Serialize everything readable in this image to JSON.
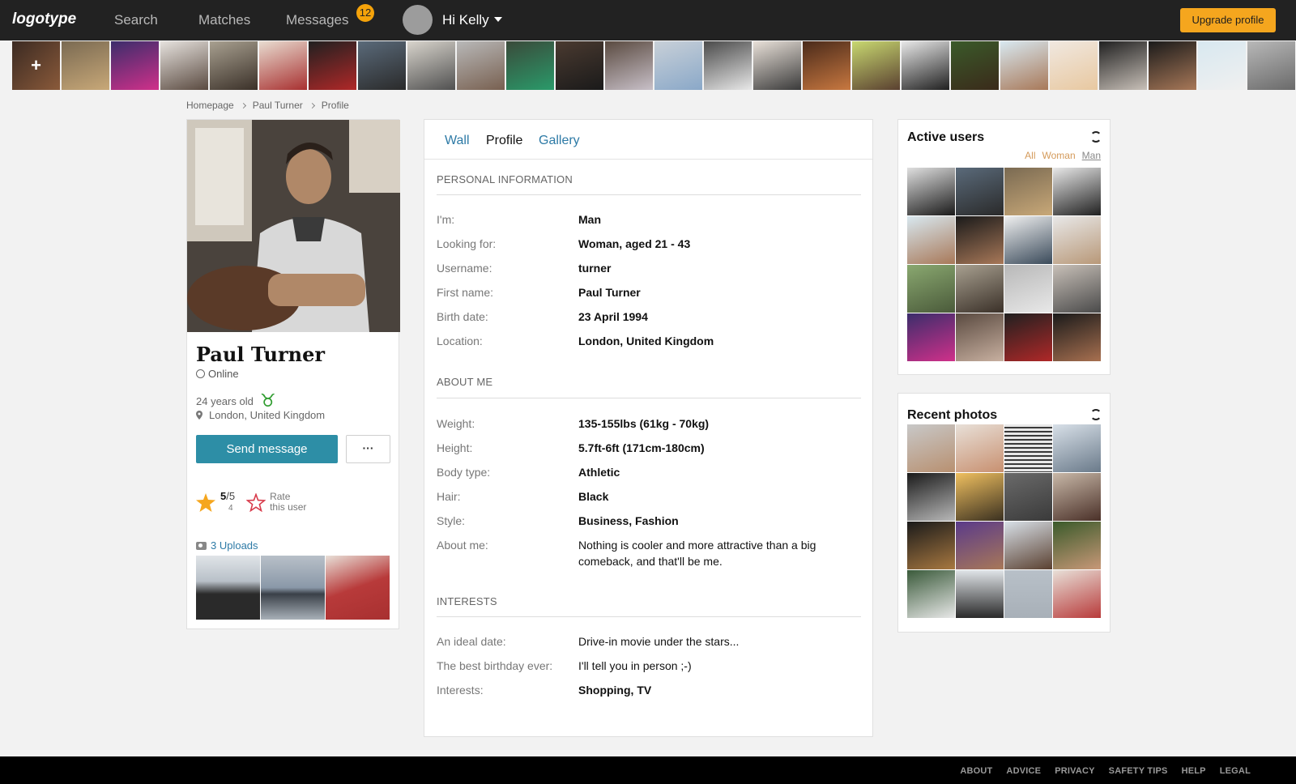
{
  "nav": {
    "logo": "logotype",
    "links": [
      "Search",
      "Matches",
      "Messages"
    ],
    "messages_badge": "12",
    "greeting": "Hi Kelly",
    "upgrade_label": "Upgrade profile"
  },
  "breadcrumb": [
    "Homepage",
    "Paul Turner",
    "Profile"
  ],
  "profile": {
    "name": "Paul Turner",
    "status": "Online",
    "age": "24 years old",
    "zodiac": "♉",
    "location": "London, United Kingdom",
    "send_message_label": "Send message",
    "more_label": "···",
    "rating_value": "5",
    "rating_max": "/5",
    "rating_count": "4",
    "rate_label_1": "Rate",
    "rate_label_2": "this user",
    "uploads_label": "3 Uploads"
  },
  "tabs": [
    "Wall",
    "Profile",
    "Gallery"
  ],
  "sections": {
    "personal": {
      "title": "PERSONAL INFORMATION",
      "rows": [
        {
          "label": "I'm:",
          "value": "Man"
        },
        {
          "label": "Looking for:",
          "value": "Woman, aged 21 - 43"
        },
        {
          "label": "Username:",
          "value": "turner"
        },
        {
          "label": "First name:",
          "value": "Paul Turner"
        },
        {
          "label": "Birth date:",
          "value": "23 April 1994"
        },
        {
          "label": "Location:",
          "value": "London, United Kingdom"
        }
      ]
    },
    "about": {
      "title": "ABOUT ME",
      "rows": [
        {
          "label": "Weight:",
          "value": "135-155lbs (61kg - 70kg)"
        },
        {
          "label": "Height:",
          "value": "5.7ft-6ft (171cm-180cm)"
        },
        {
          "label": "Body type:",
          "value": "Athletic"
        },
        {
          "label": "Hair:",
          "value": "Black"
        },
        {
          "label": "Style:",
          "value": "Business, Fashion"
        },
        {
          "label": "About me:",
          "value": "Nothing is cooler and more attractive than a big comeback, and that'll be me."
        }
      ]
    },
    "interests": {
      "title": "INTERESTS",
      "rows": [
        {
          "label": "An ideal date:",
          "value": "Drive-in movie under the stars..."
        },
        {
          "label": "The best birthday ever:",
          "value": "I'll tell you in person ;-)"
        },
        {
          "label": "Interests:",
          "value": "Shopping, TV"
        }
      ]
    }
  },
  "active_users": {
    "title": "Active users",
    "filters": [
      "All",
      "Woman",
      "Man"
    ]
  },
  "recent_photos": {
    "title": "Recent photos"
  },
  "footer": [
    "ABOUT",
    "ADVICE",
    "PRIVACY",
    "SAFETY TIPS",
    "HELP",
    "LEGAL"
  ]
}
